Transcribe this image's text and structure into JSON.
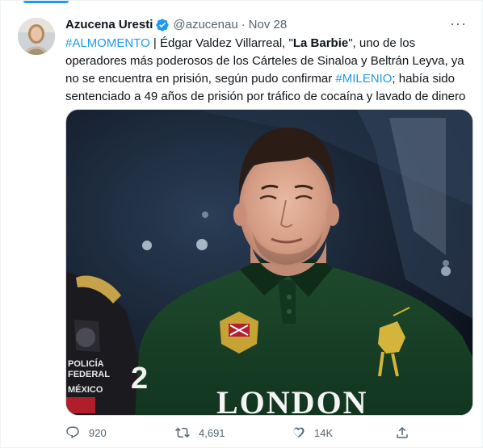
{
  "tweet": {
    "author_name": "Azucena Uresti",
    "handle": "@azucenau",
    "separator": "·",
    "date": "Nov 28",
    "more_label": "···",
    "text": {
      "hashtag1": "#ALMOMENTO",
      "part1": " | Édgar Valdez Villarreal, \"",
      "bold": "La Barbie",
      "part2": "\", uno de los operadores más poderosos de los Cárteles de Sinaloa y Beltrán Leyva, ya no se encuentra en prisión, según pudo confirmar ",
      "hashtag2": "#MILENIO",
      "part3": "; había sido sentenciado a 49 años de prisión por tráfico de cocaína y lavado de dinero"
    },
    "media": {
      "shirt_text": "LONDON",
      "badge_text_1": "POLICÍA",
      "badge_text_2": "FEDERAL",
      "badge_text_3": "MÉXICO",
      "sleeve_number": "2"
    }
  },
  "actions": {
    "replies": "920",
    "retweets": "4,691",
    "likes": "14K",
    "share": ""
  },
  "colors": {
    "accent": "#1d9bf0",
    "text_primary": "#0f1419",
    "text_secondary": "#536471"
  },
  "icons": [
    "verified-badge-icon",
    "more-icon",
    "reply-icon",
    "retweet-icon",
    "like-icon",
    "share-icon"
  ]
}
